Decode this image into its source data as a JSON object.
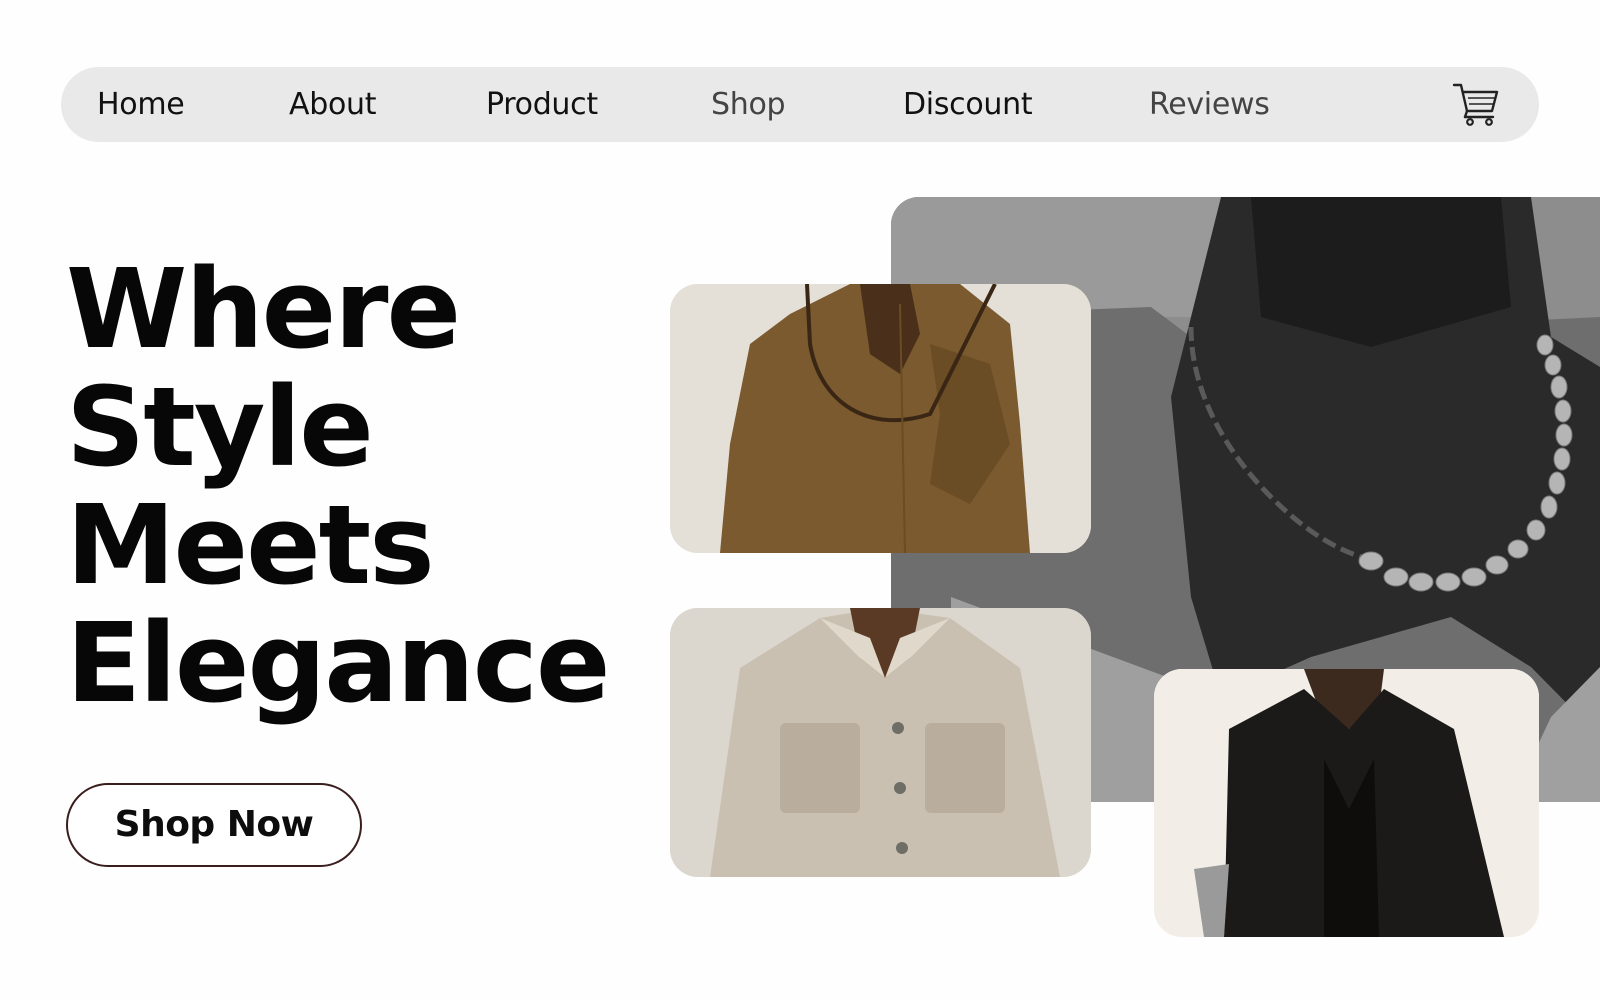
{
  "nav": {
    "items": [
      {
        "label": "Home"
      },
      {
        "label": "About"
      },
      {
        "label": "Product"
      },
      {
        "label": "Shop"
      },
      {
        "label": "Discount"
      },
      {
        "label": "Reviews"
      }
    ],
    "cart_icon": "shopping-cart-icon"
  },
  "hero": {
    "title_lines": [
      "Where",
      "Style",
      "Meets",
      "Elegance"
    ],
    "cta_label": "Shop Now"
  },
  "images": [
    {
      "name": "necklace-photo",
      "subject": "pearl-and-chain-necklace"
    },
    {
      "name": "brown-shirt-photo",
      "subject": "brown-shirt"
    },
    {
      "name": "beige-shirt-photo",
      "subject": "beige-shirt"
    },
    {
      "name": "black-blazer-photo",
      "subject": "black-blazer"
    }
  ],
  "colors": {
    "nav_background": "#e9e9e9",
    "text": "#070707",
    "cta_border": "#3a1d1d"
  }
}
